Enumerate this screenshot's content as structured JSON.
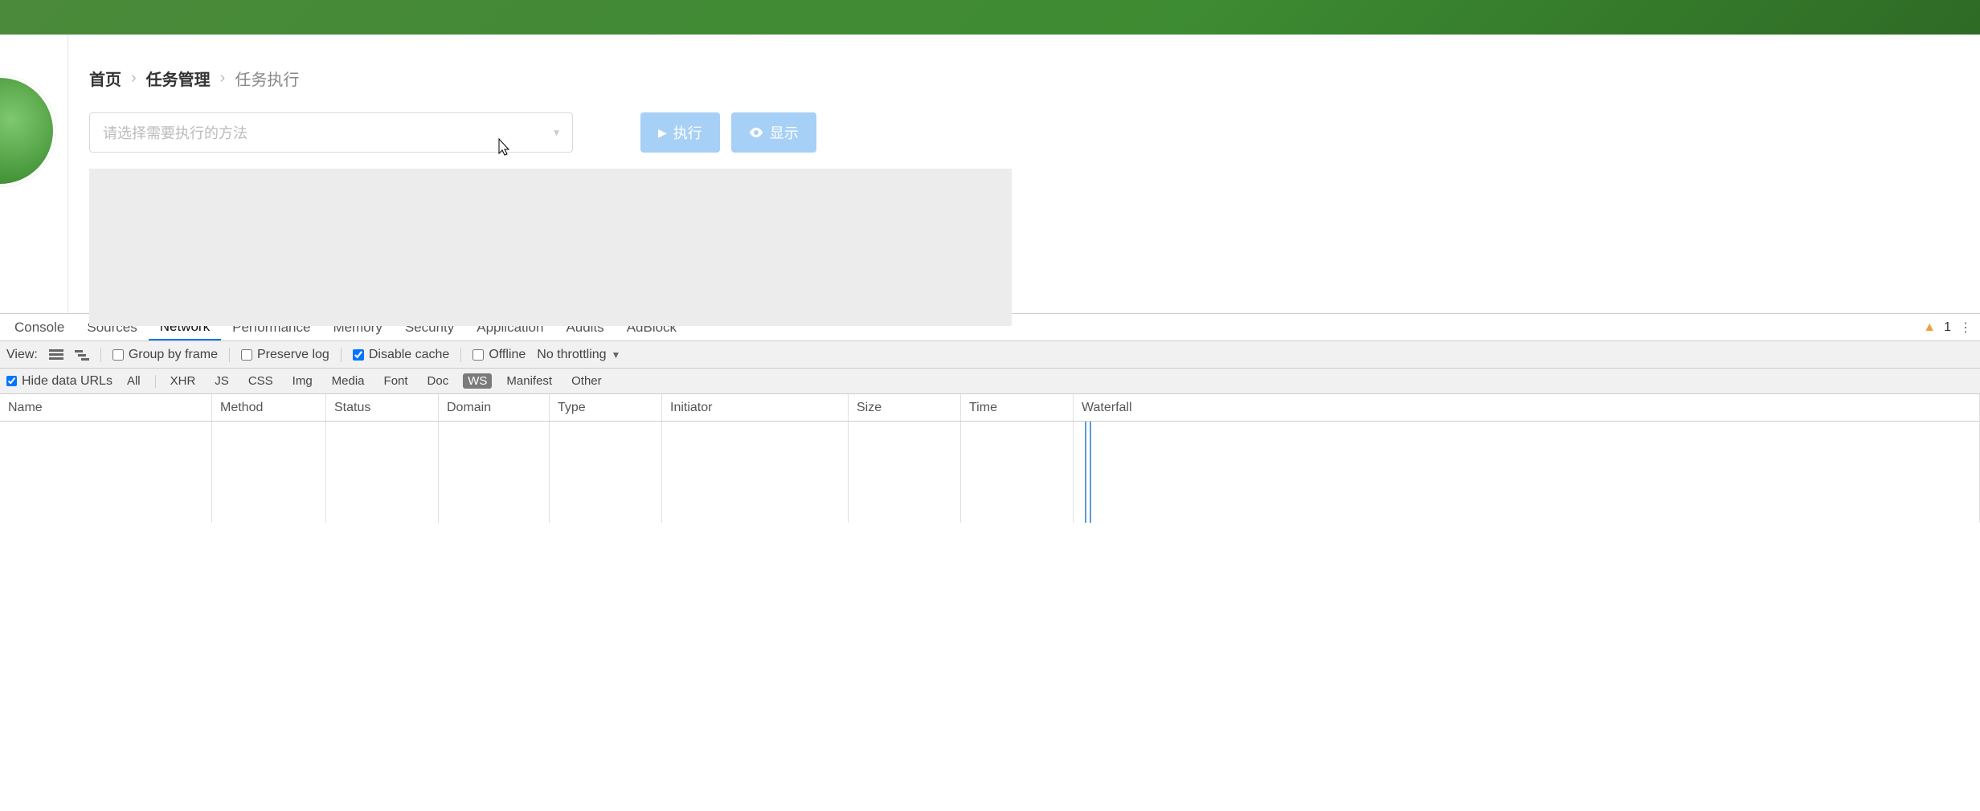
{
  "breadcrumb": {
    "home": "首页",
    "section": "任务管理",
    "page": "任务执行"
  },
  "select": {
    "placeholder": "请选择需要执行的方法"
  },
  "buttons": {
    "execute": "执行",
    "show": "显示"
  },
  "devtools": {
    "tabs": {
      "console": "Console",
      "sources": "Sources",
      "network": "Network",
      "performance": "Performance",
      "memory": "Memory",
      "security": "Security",
      "application": "Application",
      "audits": "Audits",
      "adblock": "AdBlock"
    },
    "active_tab": "network",
    "warnings_count": "1",
    "toolbar": {
      "view_label": "View:",
      "group_by_frame": "Group by frame",
      "preserve_log": "Preserve log",
      "disable_cache": "Disable cache",
      "offline": "Offline",
      "throttling": "No throttling",
      "group_by_frame_checked": false,
      "preserve_log_checked": false,
      "disable_cache_checked": true,
      "offline_checked": false
    },
    "filter": {
      "hide_data_urls": "Hide data URLs",
      "hide_data_urls_checked": true,
      "types": {
        "all": "All",
        "xhr": "XHR",
        "js": "JS",
        "css": "CSS",
        "img": "Img",
        "media": "Media",
        "font": "Font",
        "doc": "Doc",
        "ws": "WS",
        "manifest": "Manifest",
        "other": "Other"
      },
      "active_type": "ws"
    },
    "columns": {
      "name": "Name",
      "method": "Method",
      "status": "Status",
      "domain": "Domain",
      "type": "Type",
      "initiator": "Initiator",
      "size": "Size",
      "time": "Time",
      "waterfall": "Waterfall"
    },
    "rows": []
  }
}
